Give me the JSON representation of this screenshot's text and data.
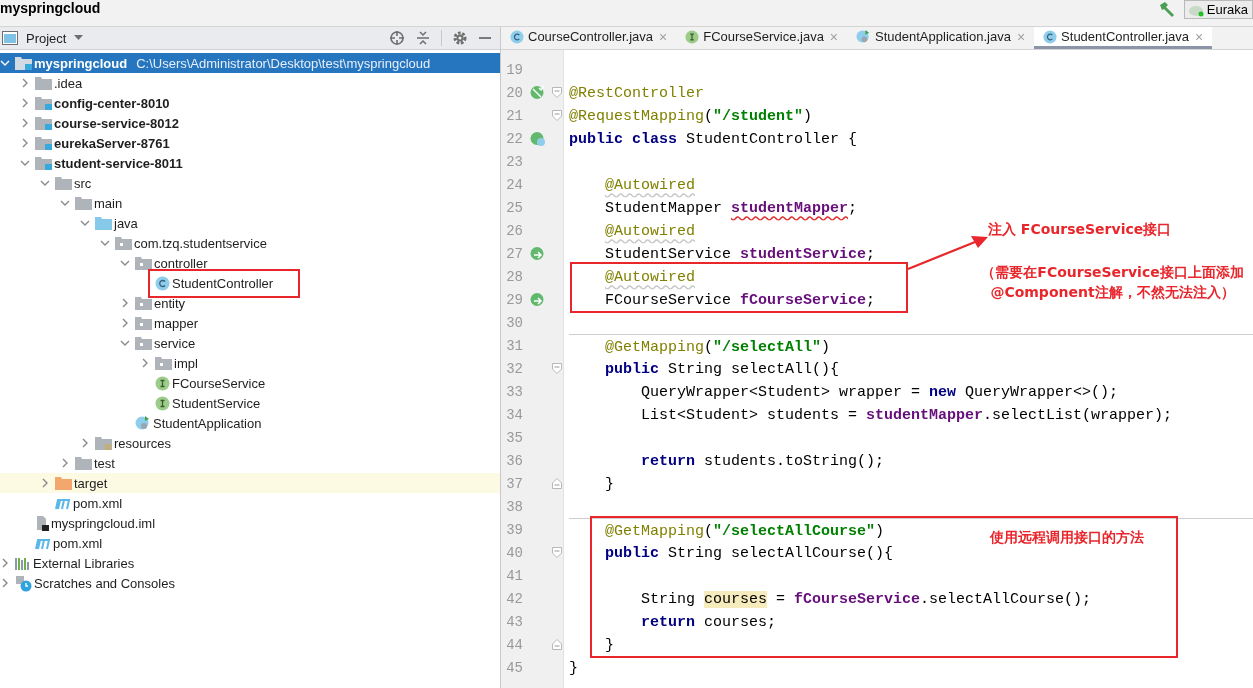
{
  "title_bar": {
    "project": "myspringcloud",
    "run_config": "Euraka"
  },
  "project_panel": {
    "title": "Project",
    "tree": [
      {
        "label": "myspringcloud",
        "path": "C:\\Users\\Administrator\\Desktop\\test\\myspringcloud",
        "kind": "module",
        "selected": true,
        "expanded": true,
        "children": [
          {
            "label": ".idea",
            "kind": "folder",
            "selected": false,
            "expanded": false
          },
          {
            "label": "config-center-8010",
            "kind": "module",
            "selected": false,
            "expanded": false
          },
          {
            "label": "course-service-8012",
            "kind": "module",
            "selected": false,
            "expanded": false
          },
          {
            "label": "eurekaServer-8761",
            "kind": "module",
            "selected": false,
            "expanded": false
          },
          {
            "label": "student-service-8011",
            "kind": "module",
            "selected": false,
            "expanded": true,
            "children": [
              {
                "label": "src",
                "kind": "folder",
                "selected": false,
                "expanded": true,
                "children": [
                  {
                    "label": "main",
                    "kind": "folder",
                    "selected": false,
                    "expanded": true,
                    "children": [
                      {
                        "label": "java",
                        "kind": "source",
                        "selected": false,
                        "expanded": true,
                        "children": [
                          {
                            "label": "com.tzq.studentservice",
                            "kind": "package",
                            "selected": false,
                            "expanded": true,
                            "children": [
                              {
                                "label": "controller",
                                "kind": "package",
                                "selected": false,
                                "expanded": true,
                                "children": [
                                  {
                                    "label": "StudentController",
                                    "kind": "class",
                                    "selected": false,
                                    "boxed": true
                                  }
                                ]
                              },
                              {
                                "label": "entity",
                                "kind": "package",
                                "selected": false,
                                "expanded": false
                              },
                              {
                                "label": "mapper",
                                "kind": "package",
                                "selected": false,
                                "expanded": false
                              },
                              {
                                "label": "service",
                                "kind": "package",
                                "selected": false,
                                "expanded": true,
                                "children": [
                                  {
                                    "label": "impl",
                                    "kind": "package",
                                    "selected": false,
                                    "expanded": false
                                  },
                                  {
                                    "label": "FCourseService",
                                    "kind": "interface",
                                    "selected": false
                                  },
                                  {
                                    "label": "StudentService",
                                    "kind": "interface",
                                    "selected": false
                                  }
                                ]
                              },
                              {
                                "label": "StudentApplication",
                                "kind": "spring_app",
                                "selected": false
                              }
                            ]
                          }
                        ]
                      },
                      {
                        "label": "resources",
                        "kind": "resources",
                        "selected": false,
                        "expanded": false
                      }
                    ]
                  },
                  {
                    "label": "test",
                    "kind": "folder",
                    "selected": false,
                    "expanded": false
                  }
                ]
              },
              {
                "label": "target",
                "kind": "excluded",
                "selected": false,
                "expanded": false
              },
              {
                "label": "pom.xml",
                "kind": "maven",
                "selected": false
              }
            ]
          },
          {
            "label": "myspringcloud.iml",
            "kind": "iml",
            "selected": false
          },
          {
            "label": "pom.xml",
            "kind": "maven",
            "selected": false
          }
        ]
      },
      {
        "label": "External Libraries",
        "kind": "libraries",
        "selected": false,
        "expanded": false
      },
      {
        "label": "Scratches and Consoles",
        "kind": "scratches",
        "selected": false,
        "expanded": false
      }
    ]
  },
  "tabs": [
    {
      "label": "CourseController.java",
      "kind": "class",
      "close": "×",
      "selected": false
    },
    {
      "label": "FCourseService.java",
      "kind": "interface",
      "close": "×",
      "selected": false
    },
    {
      "label": "StudentApplication.java",
      "kind": "spring_app",
      "close": "×",
      "selected": false
    },
    {
      "label": "StudentController.java",
      "kind": "class",
      "close": "×",
      "selected": true
    }
  ],
  "editor": {
    "lines": [
      {
        "number": "19"
      },
      {
        "number": "20",
        "gutter": {
          "kind": "check"
        },
        "fold": {
          "kind": "start"
        },
        "segments": [
          {
            "kind": "annotation",
            "text": "@RestController"
          }
        ]
      },
      {
        "number": "21",
        "fold": {
          "kind": "start"
        },
        "segments": [
          {
            "kind": "annotation",
            "text": "@RequestMapping"
          },
          {
            "kind": "plain",
            "text": "("
          },
          {
            "kind": "string",
            "text": "\"/student\""
          },
          {
            "kind": "plain",
            "text": ")"
          }
        ]
      },
      {
        "number": "22",
        "gutter": {
          "kind": "class"
        },
        "segments": [
          {
            "kind": "keyword",
            "text": "public class"
          },
          {
            "kind": "plain",
            "text": " StudentController {"
          }
        ]
      },
      {
        "number": "23"
      },
      {
        "number": "24",
        "segments": [
          {
            "kind": "annotation_warn",
            "text": "    @Autowired"
          }
        ]
      },
      {
        "number": "25",
        "segments": [
          {
            "kind": "plain",
            "text": "    StudentMapper "
          },
          {
            "kind": "field_error",
            "text": "studentMapper"
          },
          {
            "kind": "plain",
            "text": ";"
          }
        ]
      },
      {
        "number": "26",
        "segments": [
          {
            "kind": "annotation_warn",
            "text": "    @Autowired"
          }
        ]
      },
      {
        "number": "27",
        "gutter": {
          "kind": "link"
        },
        "segments": [
          {
            "kind": "plain",
            "text": "    StudentService "
          },
          {
            "kind": "field",
            "text": "studentService"
          },
          {
            "kind": "plain",
            "text": ";"
          }
        ]
      },
      {
        "number": "28",
        "boxed": true,
        "segments": [
          {
            "kind": "annotation_warn",
            "text": "    @Autowired"
          }
        ]
      },
      {
        "number": "29",
        "boxed": true,
        "gutter": {
          "kind": "link"
        },
        "segments": [
          {
            "kind": "plain",
            "text": "    FCourseService "
          },
          {
            "kind": "field",
            "text": "fCourseService"
          },
          {
            "kind": "plain",
            "text": ";"
          }
        ]
      },
      {
        "number": "30"
      },
      {
        "number": "31",
        "separator": true,
        "segments": [
          {
            "kind": "annotation",
            "text": "    @GetMapping"
          },
          {
            "kind": "plain",
            "text": "("
          },
          {
            "kind": "string",
            "text": "\"/selectAll\""
          },
          {
            "kind": "plain",
            "text": ")"
          }
        ]
      },
      {
        "number": "32",
        "fold": {
          "kind": "start"
        },
        "segments": [
          {
            "kind": "keyword",
            "text": "    public"
          },
          {
            "kind": "plain",
            "text": " String selectAll(){"
          }
        ]
      },
      {
        "number": "33",
        "segments": [
          {
            "kind": "plain",
            "text": "        QueryWrapper<Student> wrapper = "
          },
          {
            "kind": "keyword",
            "text": "new"
          },
          {
            "kind": "plain",
            "text": " QueryWrapper<>();"
          }
        ]
      },
      {
        "number": "34",
        "segments": [
          {
            "kind": "plain",
            "text": "        List<Student> students = "
          },
          {
            "kind": "field",
            "text": "studentMapper"
          },
          {
            "kind": "plain",
            "text": ".selectList(wrapper);"
          }
        ]
      },
      {
        "number": "35"
      },
      {
        "number": "36",
        "segments": [
          {
            "kind": "keyword",
            "text": "        return"
          },
          {
            "kind": "plain",
            "text": " students.toString();"
          }
        ]
      },
      {
        "number": "37",
        "fold": {
          "kind": "end"
        },
        "segments": [
          {
            "kind": "plain",
            "text": "    }"
          }
        ]
      },
      {
        "number": "38"
      },
      {
        "number": "39",
        "separator": true,
        "boxed": true,
        "segments": [
          {
            "kind": "annotation",
            "text": "    @GetMapping"
          },
          {
            "kind": "plain",
            "text": "("
          },
          {
            "kind": "string",
            "text": "\"/selectAllCourse\""
          },
          {
            "kind": "plain",
            "text": ")"
          }
        ]
      },
      {
        "number": "40",
        "boxed": true,
        "fold": {
          "kind": "start"
        },
        "segments": [
          {
            "kind": "keyword",
            "text": "    public"
          },
          {
            "kind": "plain",
            "text": " String selectAllCourse(){"
          }
        ]
      },
      {
        "number": "41",
        "boxed": true
      },
      {
        "number": "42",
        "boxed": true,
        "segments": [
          {
            "kind": "plain",
            "text": "        String "
          },
          {
            "kind": "usage",
            "text": "courses"
          },
          {
            "kind": "plain",
            "text": " = "
          },
          {
            "kind": "field",
            "text": "fCourseService"
          },
          {
            "kind": "plain",
            "text": ".selectAllCourse();"
          }
        ]
      },
      {
        "number": "43",
        "boxed": true,
        "segments": [
          {
            "kind": "keyword",
            "text": "        return"
          },
          {
            "kind": "plain",
            "text": " courses;"
          }
        ]
      },
      {
        "number": "44",
        "boxed": true,
        "fold": {
          "kind": "end"
        },
        "segments": [
          {
            "kind": "plain",
            "text": "    }"
          }
        ]
      },
      {
        "number": "45",
        "segments": [
          {
            "kind": "plain",
            "text": "}"
          }
        ]
      }
    ]
  },
  "notes": [
    {
      "lines": [
        "注入 FCourseService接口"
      ]
    },
    {
      "lines": [
        "（需要在FCourseService接口上面添加",
        "@Component注解，不然无法注入）"
      ]
    },
    {
      "lines": [
        "使用远程调用接口的方法"
      ]
    }
  ]
}
